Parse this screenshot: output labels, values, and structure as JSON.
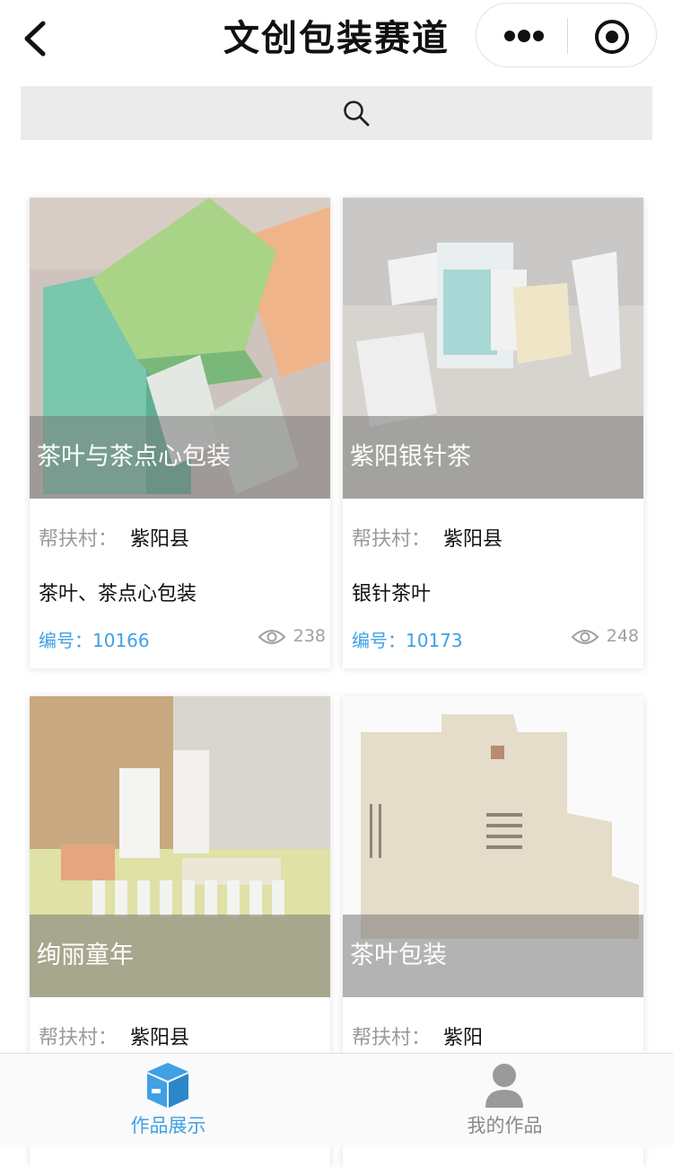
{
  "header": {
    "title": "文创包装赛道"
  },
  "search": {
    "placeholder": ""
  },
  "labels": {
    "village_label": "帮扶村：",
    "id_prefix": "编号："
  },
  "cards": [
    {
      "title": "茶叶与茶点心包装",
      "village": "紫阳县",
      "description": "茶叶、茶点心包装",
      "id": "10166",
      "views": "238"
    },
    {
      "title": "紫阳银针茶",
      "village": "紫阳县",
      "description": "银针茶叶",
      "id": "10173",
      "views": "248"
    },
    {
      "title": "绚丽童年",
      "village": "紫阳县",
      "description": "",
      "id": "",
      "views": ""
    },
    {
      "title": "茶叶包装",
      "village": "紫阳",
      "description": "",
      "id": "",
      "views": ""
    }
  ],
  "tabbar": {
    "tabs": [
      {
        "label": "作品展示",
        "active": true
      },
      {
        "label": "我的作品",
        "active": false
      }
    ]
  },
  "colors": {
    "accent": "#3fa0e6",
    "inactive": "#8a8a8a",
    "header_bg": "#ffffff",
    "search_bg": "#ebebeb"
  }
}
